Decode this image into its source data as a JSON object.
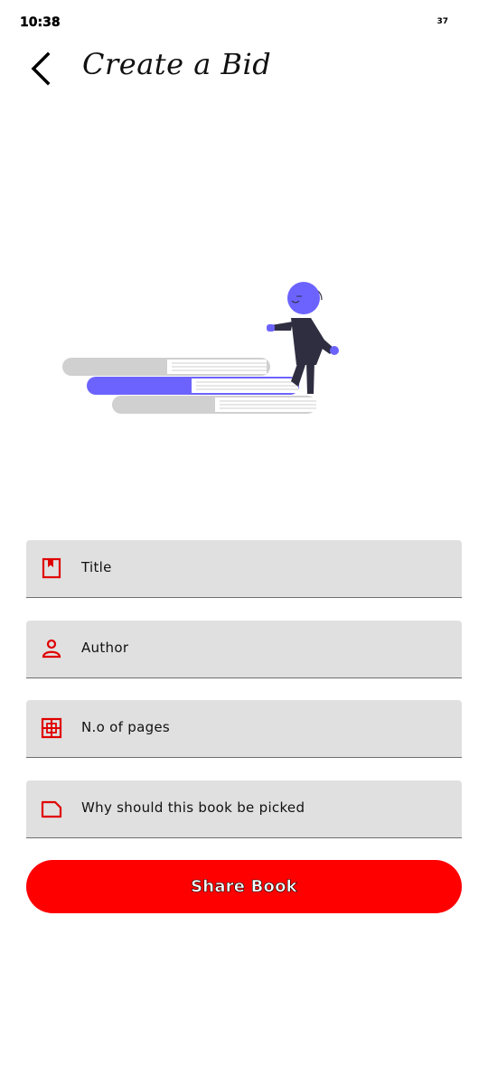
{
  "status_bar": {
    "time": "10:38",
    "battery": "37"
  },
  "header": {
    "title": "Create a Bid",
    "back_icon": "back-arrow-icon"
  },
  "form": {
    "fields": [
      {
        "label": "Title",
        "icon": "bookmark-icon"
      },
      {
        "label": "Author",
        "icon": "person-icon"
      },
      {
        "label": "N.o of pages",
        "icon": "pages-grid-icon"
      },
      {
        "label": "Why should this book be picked",
        "icon": "note-icon"
      }
    ],
    "submit_label": "Share Book"
  },
  "colors": {
    "accent": "#ff0000",
    "illustration": "#6c63ff",
    "field_bg": "#e0e0e0"
  }
}
